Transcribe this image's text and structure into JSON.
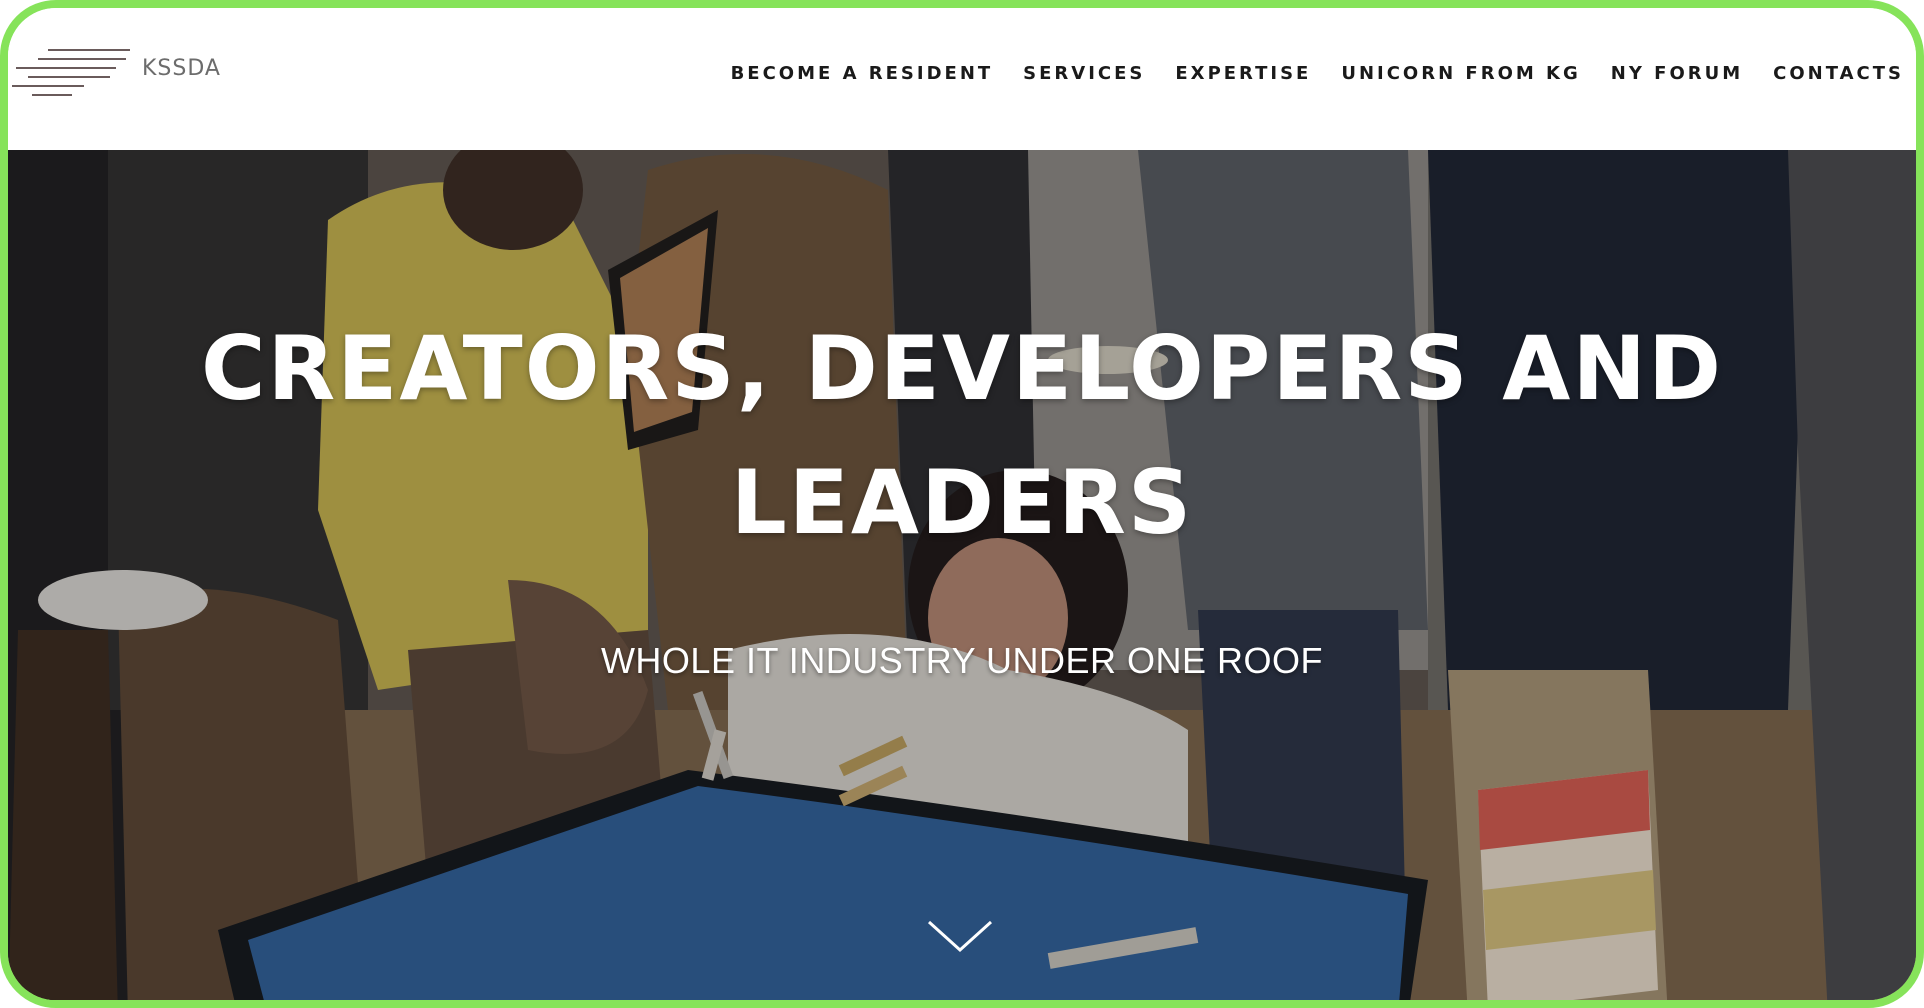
{
  "brand": {
    "name": "KSSDA"
  },
  "nav": {
    "items": [
      {
        "label": "BECOME A RESIDENT"
      },
      {
        "label": "SERVICES"
      },
      {
        "label": "EXPERTISE"
      },
      {
        "label": "UNICORN FROM KG"
      },
      {
        "label": "NY FORUM"
      },
      {
        "label": "CONTACTS"
      }
    ]
  },
  "hero": {
    "title_line1": "CREATORS, DEVELOPERS AND",
    "title_line2": "LEADERS",
    "subtitle": "WHOLE IT INDUSTRY UNDER ONE ROOF",
    "scroll_icon": "chevron-down-icon"
  },
  "colors": {
    "frame_border": "#86e35a",
    "nav_text": "#1a1a1a",
    "hero_text": "#ffffff",
    "logo_lines": "#6a5b5b"
  }
}
